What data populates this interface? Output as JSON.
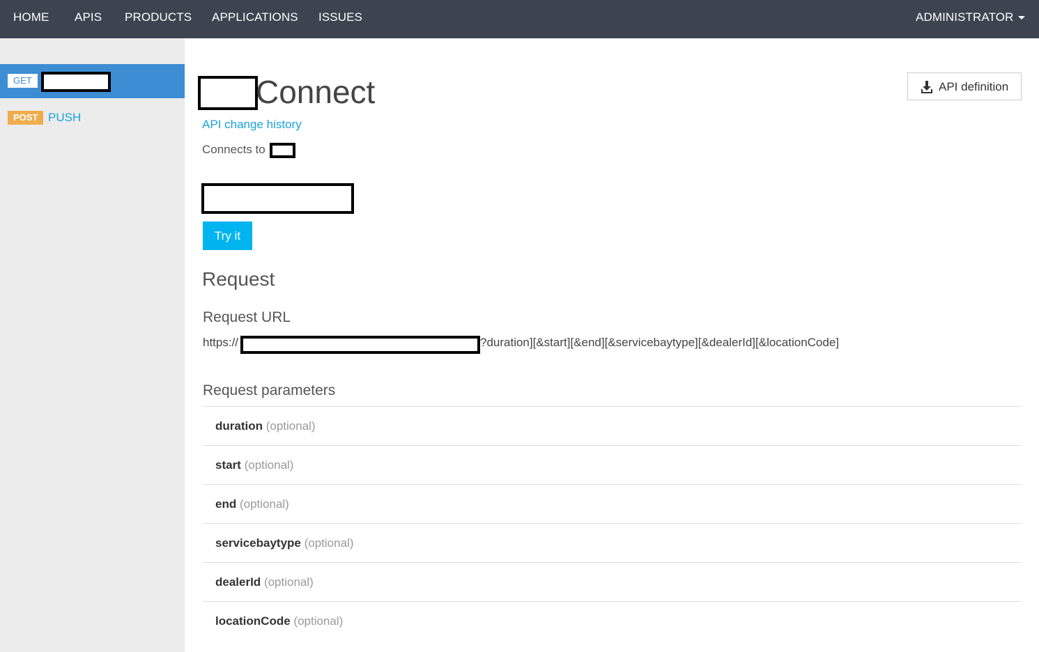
{
  "nav": {
    "items": [
      "HOME",
      "APIS",
      "PRODUCTS",
      "APPLICATIONS",
      "ISSUES"
    ],
    "user": "ADMINISTRATOR"
  },
  "sidebar": {
    "operations": [
      {
        "method": "GET",
        "name": ""
      },
      {
        "method": "POST",
        "name": "PUSH"
      }
    ]
  },
  "api": {
    "title": "Connect",
    "change_history_link": "API change history",
    "connects_to_label": "Connects to",
    "definition_button": "API definition",
    "try_button": "Try it"
  },
  "request": {
    "heading": "Request",
    "url_heading": "Request URL",
    "url_prefix": "https://",
    "url_suffix": "?duration][&start][&end][&servicebaytype][&dealerId][&locationCode]",
    "params_heading": "Request parameters",
    "params": [
      {
        "name": "duration",
        "qualifier": "(optional)"
      },
      {
        "name": "start",
        "qualifier": "(optional)"
      },
      {
        "name": "end",
        "qualifier": "(optional)"
      },
      {
        "name": "servicebaytype",
        "qualifier": "(optional)"
      },
      {
        "name": "dealerId",
        "qualifier": "(optional)"
      },
      {
        "name": "locationCode",
        "qualifier": "(optional)"
      }
    ]
  },
  "colors": {
    "nav_bg": "#3d4450",
    "active_bg": "#3c8dd4",
    "link": "#1aa3d9",
    "try_button": "#00b4ef",
    "post_badge": "#f0ad4e"
  }
}
